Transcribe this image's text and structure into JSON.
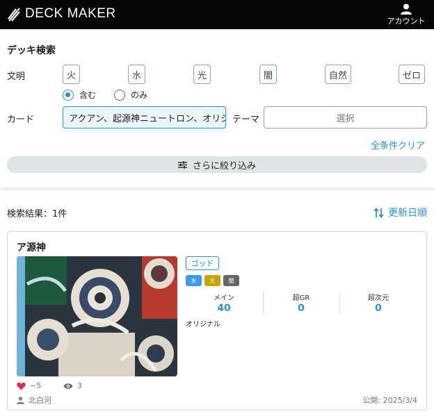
{
  "header": {
    "logo_text": "DECK MAKER",
    "account_label": "アカウント",
    "background": "#050608"
  },
  "search": {
    "title": "デッキ検索",
    "civilization_label": "文明",
    "civilizations": [
      "火",
      "水",
      "光",
      "闇",
      "自然",
      "ゼロ"
    ],
    "match_options": [
      {
        "label": "含む",
        "selected": true
      },
      {
        "label": "のみ",
        "selected": false
      }
    ],
    "card_label": "カード",
    "card_value": "アクアン、起源神ニュートロン、オリジン",
    "theme_label": "テーマ",
    "theme_placeholder": "選択",
    "clear_all": "全条件クリア",
    "refine": "さらに絞り込み"
  },
  "results": {
    "count_label": "検索結果：1件",
    "sort_label": "更新日順"
  },
  "deck": {
    "name": "ア源神",
    "type_badge": "ゴッド",
    "civ_badges": [
      {
        "label": "水",
        "color": "#3d9be9"
      },
      {
        "label": "光",
        "color": "#c9a400"
      },
      {
        "label": "闇",
        "color": "#666666"
      }
    ],
    "stats": [
      {
        "label": "メイン",
        "value": "40"
      },
      {
        "label": "超GR",
        "value": "0"
      },
      {
        "label": "超次元",
        "value": "0"
      }
    ],
    "format": "オリジナル",
    "likes": "~5",
    "views": "3",
    "author": "北白河",
    "published": "公開: 2025/3/4"
  },
  "colors": {
    "accent": "#2a95c4",
    "like": "#e0304e"
  }
}
